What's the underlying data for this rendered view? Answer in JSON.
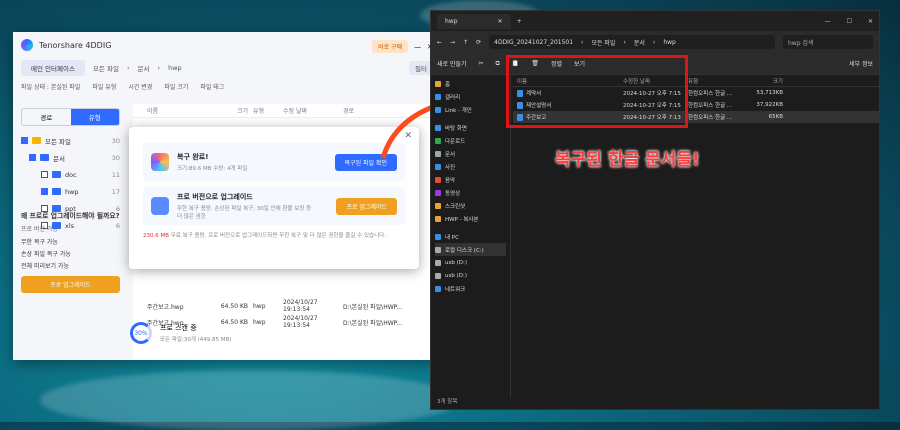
{
  "app": {
    "title": "Tenorshare 4DDIG",
    "buy": "바로 구매",
    "home": "메인 인터페이스",
    "breadcrumb": [
      "모든 파일",
      "문서",
      "hwp"
    ],
    "filter_btn": "필터"
  },
  "filters": {
    "state": "파일 상태 : 본실된 파일",
    "type": "파일 유형",
    "time": "시간 변경",
    "size": "파일 크기",
    "tag": "파일 태그"
  },
  "seg": {
    "path": "경로",
    "type": "유형"
  },
  "tree": [
    {
      "label": "모든 파일",
      "count": "30"
    },
    {
      "label": "문서",
      "count": "30"
    },
    {
      "label": "doc",
      "count": "11"
    },
    {
      "label": "hwp",
      "count": "17"
    },
    {
      "label": "ppt",
      "count": "6"
    },
    {
      "label": "xls",
      "count": "6"
    }
  ],
  "promo": {
    "title": "왜 프로로 업그레이드해야 될까요?",
    "free": "프로 버전 가능",
    "f1": "무한 복구 가능",
    "f2": "손상 파일 복구 가능",
    "f3": "전체 미리보기 가능",
    "btn": "프로 업그레이드"
  },
  "table": {
    "headers": [
      "이름",
      "크기",
      "유형",
      "수정 날짜",
      "경로"
    ],
    "rows": [
      [
        "주간보고.hwp",
        "64.50 KB",
        "hwp",
        "2024/10/27 19:13:54",
        "D:\\본실된 파일\\HWP..."
      ],
      [
        "주간보고.hwp",
        "64.50 KB",
        "hwp",
        "2024/10/27 19:13:54",
        "D:\\본실된 파일\\HWP..."
      ]
    ]
  },
  "scan": {
    "pct": "30%",
    "title": "프로 스캔 중",
    "sub": "모든 파일:30개 (449.85 MB)"
  },
  "dialog": {
    "t1": "복구 완료!",
    "s1": "크기:89.6 MB  수량: 4개 파일",
    "b1": "복구된 파일 확인",
    "t2": "프로 버전으로 업그레이드",
    "s2": "무한 복구 용량, 손상된 파일 복구, 30일 안에 환불 보장 등 더 많은 권한",
    "b2": "프로 업그레이드",
    "note_hl": "230.6 MB",
    "note": " 무료 복구 용량, 프로 버전으로 업그레이드하면 무한 복구 및 더 많은 권한을 즐길 수 있습니다."
  },
  "explorer": {
    "tab": "hwp",
    "path": [
      "4DDIG_20241027_201501",
      "모든 파일",
      "문서",
      "hwp"
    ],
    "search": "hwp 검색",
    "new": "새로 만들기",
    "sort": "정렬",
    "view": "보기",
    "details": "세부 정보",
    "side": [
      "홈",
      "갤러리",
      "Link - 개인",
      "바탕 화면",
      "다운로드",
      "문서",
      "사진",
      "음악",
      "동영상",
      "스크린샷",
      "HWP - 복사본",
      "내 PC",
      "로컬 디스크 (C:)",
      "usb (D:)",
      "usb (D:)",
      "네트워크"
    ],
    "headers": [
      "이름",
      "수정한 날짜",
      "유형",
      "크기"
    ],
    "files": [
      [
        "계약서",
        "2024-10-27 오후 7:15",
        "한컴오피스 한글 ...",
        "53,713KB"
      ],
      [
        "제안설명서",
        "2024-10-27 오후 7:15",
        "한컴오피스 한글 ...",
        "37,922KB"
      ],
      [
        "주간보고",
        "2024-10-27 오후 7:13",
        "한컴오피스 한글 ...",
        "65KB"
      ]
    ],
    "status": "3개 항목"
  },
  "annotation": "복구된 한글 문서들!"
}
